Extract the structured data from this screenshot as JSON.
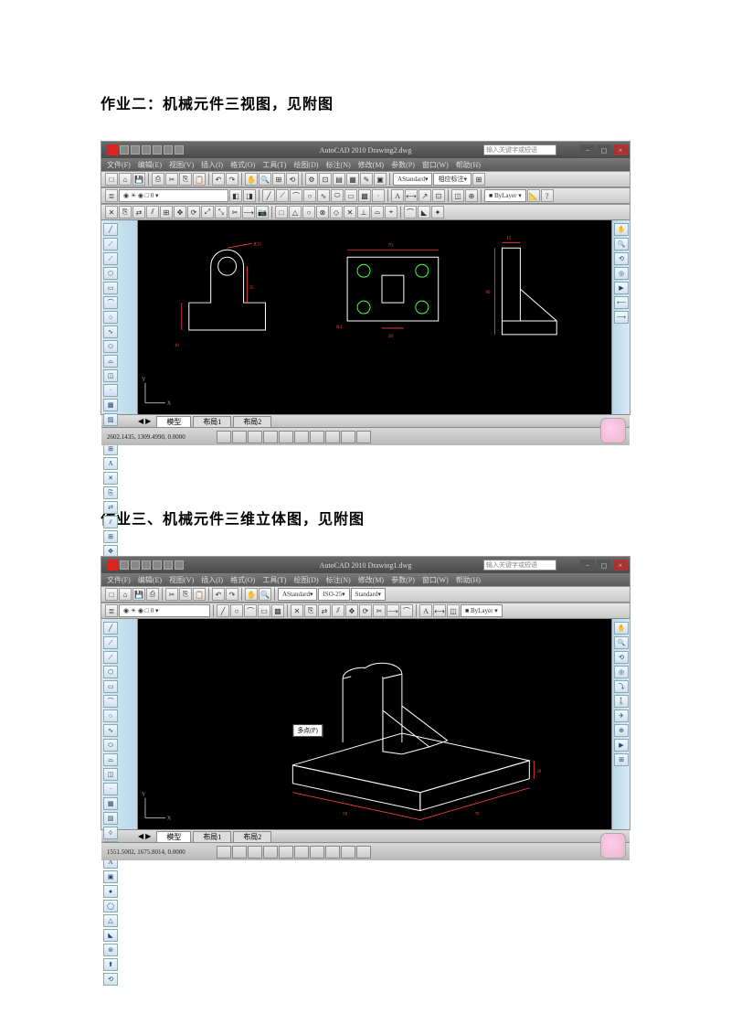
{
  "doc": {
    "heading1": "作业二：机械元件三视图，见附图",
    "heading2": "作业三、机械元件三维立体图，见附图"
  },
  "cad1": {
    "title": "AutoCAD 2010    Drawing2.dwg",
    "searchPlaceholder": "输入关键字或短语",
    "menus": [
      "文件(F)",
      "编辑(E)",
      "视图(V)",
      "插入(I)",
      "格式(O)",
      "工具(T)",
      "绘图(D)",
      "标注(N)",
      "修改(M)",
      "参数(P)",
      "窗口(W)",
      "帮助(H)"
    ],
    "dropdowns": {
      "style": "Standard",
      "dim": "相应标注"
    },
    "tabs": {
      "model": "模型",
      "layout1": "布局1",
      "layout2": "布局2"
    },
    "status": {
      "coords": "2602.1435, 1309.4990, 0.0000"
    },
    "drawing": {
      "dims": {
        "r15": "R15",
        "d60": "60",
        "d35": "35",
        "d70": "70",
        "d12": "12",
        "d10": "10",
        "d38": "38",
        "r4": "R4"
      }
    }
  },
  "cad2": {
    "title": "AutoCAD 2010    Drawing1.dwg",
    "searchPlaceholder": "输入关键字或短语",
    "menus": [
      "文件(F)",
      "编辑(E)",
      "视图(V)",
      "插入(I)",
      "格式(O)",
      "工具(T)",
      "绘图(D)",
      "标注(N)",
      "修改(M)",
      "参数(P)",
      "窗口(W)",
      "帮助(H)"
    ],
    "dropdowns": {
      "style": "Standard",
      "iso": "ISO-25"
    },
    "tabs": {
      "model": "模型",
      "layout1": "布局1",
      "layout2": "布局2"
    },
    "status": {
      "coords": "1551.5002, 1675.8014, 0.0000"
    },
    "tooltip": "多点(P)",
    "drawing": {
      "dims": {
        "d70": "70",
        "d20": "20",
        "d50": "50"
      }
    }
  }
}
